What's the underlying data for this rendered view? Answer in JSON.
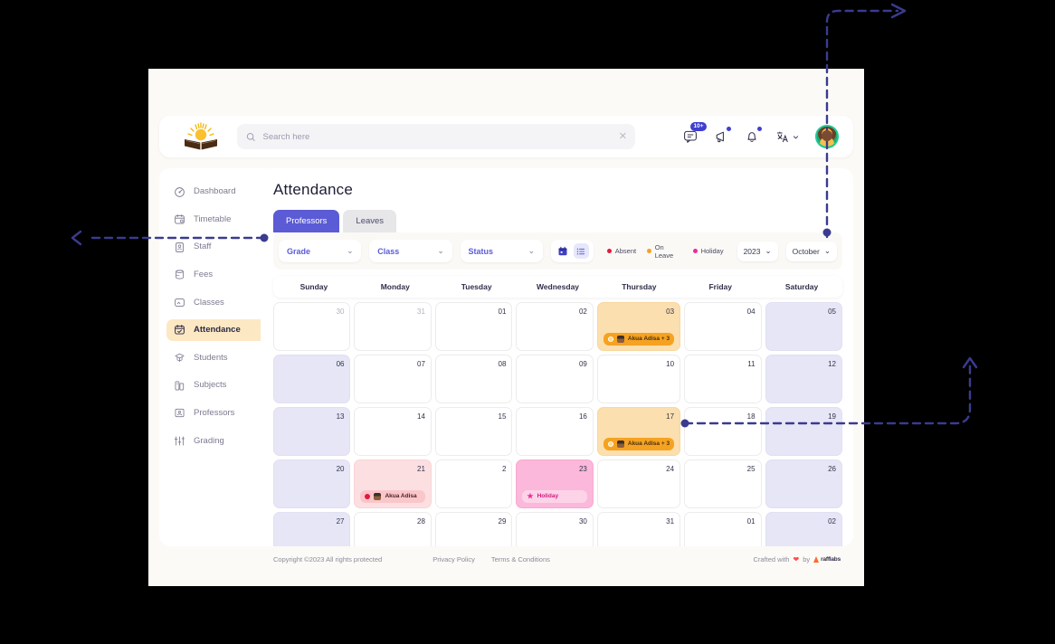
{
  "app": {
    "brand_logo": "sun-over-book-logo"
  },
  "search": {
    "placeholder": "Search here",
    "value": "",
    "icon": "search-icon",
    "clear_icon": "close-icon"
  },
  "topbar": {
    "icons": [
      {
        "name": "messages-icon",
        "badge": "10+"
      },
      {
        "name": "announcement-icon",
        "badge": ""
      },
      {
        "name": "notifications-icon",
        "badge": ""
      },
      {
        "name": "language-switcher-icon",
        "badge": ""
      }
    ],
    "messages_badge": "10+",
    "avatar": "user-avatar"
  },
  "sidebar": {
    "items": [
      {
        "label": "Dashboard",
        "icon": "dashboard-icon",
        "active": false
      },
      {
        "label": "Timetable",
        "icon": "timetable-icon",
        "active": false
      },
      {
        "label": "Staff",
        "icon": "staff-icon",
        "active": false
      },
      {
        "label": "Fees",
        "icon": "fees-icon",
        "active": false
      },
      {
        "label": "Classes",
        "icon": "classes-icon",
        "active": false
      },
      {
        "label": "Attendance",
        "icon": "attendance-icon",
        "active": true
      },
      {
        "label": "Students",
        "icon": "students-icon",
        "active": false
      },
      {
        "label": "Subjects",
        "icon": "subjects-icon",
        "active": false
      },
      {
        "label": "Professors",
        "icon": "professors-icon",
        "active": false
      },
      {
        "label": "Grading",
        "icon": "grading-icon",
        "active": false
      }
    ]
  },
  "main": {
    "title": "Attendance",
    "tabs": [
      {
        "label": "Professors",
        "active": true
      },
      {
        "label": "Leaves",
        "active": false
      }
    ],
    "filters": [
      {
        "label": "Grade"
      },
      {
        "label": "Class"
      },
      {
        "label": "Status"
      }
    ],
    "view_toggle": [
      {
        "name": "calendar-view-button",
        "selected": false
      },
      {
        "name": "list-view-button",
        "selected": true
      }
    ],
    "legend": [
      {
        "label": "Absent",
        "color": "#e8173e"
      },
      {
        "label": "On Leave",
        "color": "#f6a221"
      },
      {
        "label": "Holiday",
        "color": "#ef2b96"
      }
    ],
    "year": "2023",
    "month": "October"
  },
  "calendar": {
    "day_headers": [
      "Sunday",
      "Monday",
      "Tuesday",
      "Wednesday",
      "Thursday",
      "Friday",
      "Saturday"
    ],
    "cells": [
      {
        "day": "30",
        "muted": true,
        "state": "normal",
        "event": null
      },
      {
        "day": "31",
        "muted": true,
        "state": "normal",
        "event": null
      },
      {
        "day": "01",
        "muted": false,
        "state": "normal",
        "event": null
      },
      {
        "day": "02",
        "muted": false,
        "state": "normal",
        "event": null
      },
      {
        "day": "03",
        "muted": false,
        "state": "leave",
        "event": {
          "type": "leave",
          "text": "Akua Adisa + 3"
        }
      },
      {
        "day": "04",
        "muted": false,
        "state": "normal",
        "event": null
      },
      {
        "day": "05",
        "muted": false,
        "state": "weekend",
        "event": null
      },
      {
        "day": "06",
        "muted": false,
        "state": "weekend",
        "event": null
      },
      {
        "day": "07",
        "muted": false,
        "state": "normal",
        "event": null
      },
      {
        "day": "08",
        "muted": false,
        "state": "normal",
        "event": null
      },
      {
        "day": "09",
        "muted": false,
        "state": "normal",
        "event": null
      },
      {
        "day": "10",
        "muted": false,
        "state": "normal",
        "event": null
      },
      {
        "day": "11",
        "muted": false,
        "state": "normal",
        "event": null
      },
      {
        "day": "12",
        "muted": false,
        "state": "weekend",
        "event": null
      },
      {
        "day": "13",
        "muted": false,
        "state": "weekend",
        "event": null
      },
      {
        "day": "14",
        "muted": false,
        "state": "normal",
        "event": null
      },
      {
        "day": "15",
        "muted": false,
        "state": "normal",
        "event": null
      },
      {
        "day": "16",
        "muted": false,
        "state": "normal",
        "event": null
      },
      {
        "day": "17",
        "muted": false,
        "state": "leave",
        "event": {
          "type": "leave",
          "text": "Akua Adisa + 3"
        }
      },
      {
        "day": "18",
        "muted": false,
        "state": "normal",
        "event": null
      },
      {
        "day": "19",
        "muted": false,
        "state": "weekend",
        "event": null
      },
      {
        "day": "20",
        "muted": false,
        "state": "weekend",
        "event": null
      },
      {
        "day": "21",
        "muted": false,
        "state": "absent",
        "event": {
          "type": "absent",
          "text": "Akua Adisa"
        }
      },
      {
        "day": "2",
        "muted": false,
        "state": "normal",
        "event": null
      },
      {
        "day": "23",
        "muted": false,
        "state": "holiday",
        "event": {
          "type": "holiday",
          "text": "Holiday"
        }
      },
      {
        "day": "24",
        "muted": false,
        "state": "normal",
        "event": null
      },
      {
        "day": "25",
        "muted": false,
        "state": "normal",
        "event": null
      },
      {
        "day": "26",
        "muted": false,
        "state": "weekend",
        "event": null
      },
      {
        "day": "27",
        "muted": false,
        "state": "weekend",
        "event": null
      },
      {
        "day": "28",
        "muted": false,
        "state": "normal",
        "event": null
      },
      {
        "day": "29",
        "muted": false,
        "state": "normal",
        "event": null
      },
      {
        "day": "30",
        "muted": false,
        "state": "normal",
        "event": null
      },
      {
        "day": "31",
        "muted": false,
        "state": "normal",
        "event": null
      },
      {
        "day": "01",
        "muted": false,
        "state": "normal",
        "event": null
      },
      {
        "day": "02",
        "muted": false,
        "state": "weekend",
        "event": null
      }
    ]
  },
  "footer": {
    "copyright": "Copyright ©2023 All rights protected",
    "links": [
      "Privacy Policy",
      "Terms & Conditions"
    ],
    "crafted_prefix": "Crafted with",
    "heart": "❤",
    "crafted_by": "by",
    "brand": "rafflabs"
  },
  "colors": {
    "accent_purple": "#5b5bd6",
    "active_nav_bg": "#fde8c4",
    "absent": "#e8173e",
    "on_leave": "#f6a221",
    "holiday": "#ef2b96",
    "annotation": "#3b3b8f",
    "page_bg": "#000000",
    "app_bg": "#fcfaf6"
  }
}
